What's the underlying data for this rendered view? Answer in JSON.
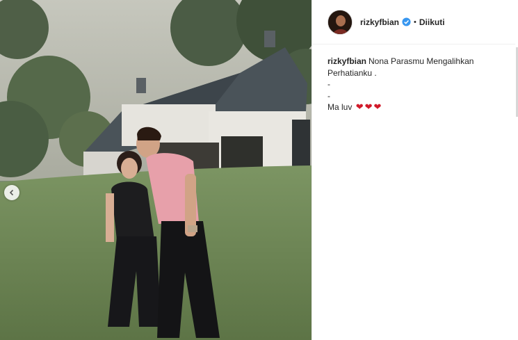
{
  "post": {
    "username": "rizkyfbian",
    "follow_separator": "•",
    "follow_label": "Diikuti",
    "caption_username": "rizkyfbian",
    "caption_line1": "Nona Parasmu Mengalihkan",
    "caption_line2": "Perhatianku .",
    "caption_line3": "-",
    "caption_line4": "-",
    "caption_line5": "Ma luv",
    "hearts": [
      "❤",
      "❤",
      "❤"
    ]
  },
  "icons": {
    "carousel_prev": "chevron-left-icon",
    "verified": "verified-badge-icon"
  },
  "colors": {
    "text": "#262626",
    "verified_blue": "#3897f0",
    "heart_red": "#d11a2a",
    "divider": "#efefef"
  }
}
